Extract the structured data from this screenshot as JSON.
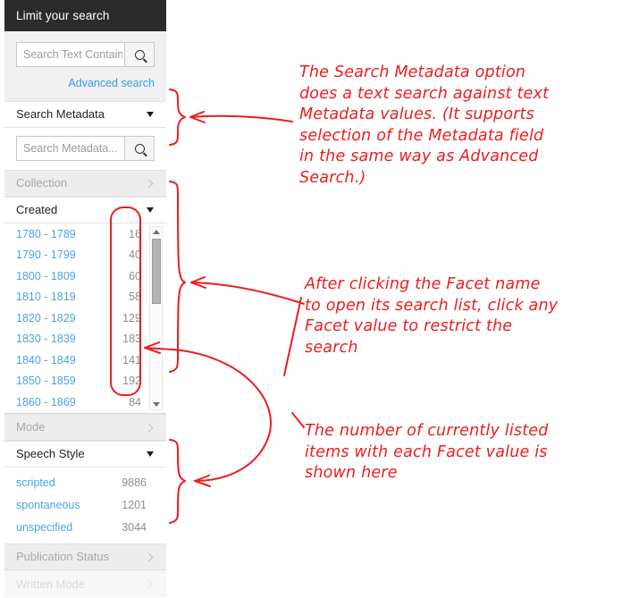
{
  "panel": {
    "header_title": "Limit your search",
    "text_search": {
      "placeholder": "Search Text Containing",
      "value": "",
      "search_icon": "magnifier-icon"
    },
    "advanced_search_label": "Advanced search",
    "metadata_facet": {
      "label": "Search Metadata",
      "state": "open",
      "chevron": "chevron-down-icon",
      "placeholder": "Search Metadata...",
      "value": "",
      "search_icon": "magnifier-icon"
    },
    "collection_facet": {
      "label": "Collection",
      "state": "closed",
      "chevron": "chevron-right-icon"
    },
    "created_facet": {
      "label": "Created",
      "state": "open",
      "chevron": "chevron-down-icon",
      "values": [
        {
          "label": "1780 - 1789",
          "count": "16"
        },
        {
          "label": "1790 - 1799",
          "count": "40"
        },
        {
          "label": "1800 - 1809",
          "count": "60"
        },
        {
          "label": "1810 - 1819",
          "count": "58"
        },
        {
          "label": "1820 - 1829",
          "count": "129"
        },
        {
          "label": "1830 - 1839",
          "count": "183"
        },
        {
          "label": "1840 - 1849",
          "count": "141"
        },
        {
          "label": "1850 - 1859",
          "count": "192"
        },
        {
          "label": "1860 - 1869",
          "count": "84"
        }
      ],
      "scrollbar": {
        "up_arrow": "scroll-up-arrow-icon",
        "down_arrow": "scroll-down-arrow-icon",
        "thumb": "scrollbar-thumb"
      }
    },
    "mode_facet": {
      "label": "Mode",
      "state": "closed",
      "chevron": "chevron-right-icon"
    },
    "speech_style_facet": {
      "label": "Speech Style",
      "state": "open",
      "chevron": "chevron-down-icon",
      "values": [
        {
          "label": "scripted",
          "count": "9886"
        },
        {
          "label": "spontaneous",
          "count": "1201"
        },
        {
          "label": "unspecified",
          "count": "3044"
        }
      ]
    },
    "publication_status_facet": {
      "label": "Publication Status",
      "state": "closed",
      "chevron": "chevron-right-icon"
    },
    "written_mode_facet": {
      "label": "Written Mode",
      "state": "closed",
      "chevron": "chevron-right-icon"
    }
  },
  "annotations": {
    "color": "#ee1c1c",
    "note_metadata": "The Search Metadata option\ndoes a text search against text\nMetadata values. (It supports\nselection of the Metadata field\nin the same way as Advanced\nSearch.)",
    "note_facet_click": "After clicking the Facet name\nto open its search list, click any\nFacet value to restrict the\nsearch",
    "note_counts": "The number of currently listed\nitems with each Facet value is\nshown here"
  }
}
